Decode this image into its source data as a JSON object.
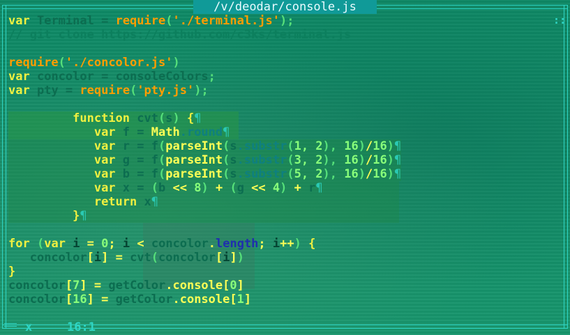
{
  "title": "/v/deodar/console.js",
  "corner_mark": "::",
  "status": {
    "mode": "x",
    "position": "16:1"
  },
  "colors": {
    "background": "#128a63",
    "frame": "#2fd6c5",
    "title_bg": "#109a98"
  },
  "lines": [
    [
      [
        "var",
        "kw"
      ],
      [
        " ",
        ""
      ],
      [
        "Terminal",
        "var-dim"
      ],
      [
        " = ",
        "op"
      ],
      [
        "require",
        "str"
      ],
      [
        "(",
        "brk"
      ],
      [
        "'./terminal.js'",
        "str"
      ],
      [
        ");",
        "brk"
      ]
    ],
    [
      [
        "// git clone https://github.com/c3ks/terminal.js",
        "cmt"
      ]
    ],
    [],
    [
      [
        "require",
        "str"
      ],
      [
        "(",
        "brk"
      ],
      [
        "'./concolor.js'",
        "str"
      ],
      [
        ")",
        "brk"
      ]
    ],
    [
      [
        "var",
        "kw"
      ],
      [
        " ",
        ""
      ],
      [
        "concolor",
        "var-dim"
      ],
      [
        " = ",
        "op"
      ],
      [
        "consoleColors",
        "var-dim"
      ],
      [
        ";",
        "brk"
      ]
    ],
    [
      [
        "var",
        "kw"
      ],
      [
        " ",
        ""
      ],
      [
        "pty",
        "var-dim"
      ],
      [
        " = ",
        "op"
      ],
      [
        "require",
        "str"
      ],
      [
        "(",
        "brk"
      ],
      [
        "'pty.js'",
        "str"
      ],
      [
        ");",
        "brk"
      ]
    ],
    [],
    [
      [
        "         ",
        ""
      ],
      [
        "function",
        "kw"
      ],
      [
        " ",
        ""
      ],
      [
        "cvt",
        "var-dim"
      ],
      [
        "(",
        "brk"
      ],
      [
        "s",
        "var-dim"
      ],
      [
        ")",
        "brk"
      ],
      [
        " {",
        "kw"
      ],
      [
        "¶",
        "pil"
      ]
    ],
    [
      [
        "            ",
        ""
      ],
      [
        "var",
        "kw"
      ],
      [
        " ",
        ""
      ],
      [
        "f",
        "var-dim"
      ],
      [
        " = ",
        "op"
      ],
      [
        "Math",
        "fn"
      ],
      [
        ".round",
        "prop"
      ],
      [
        "¶",
        "pil"
      ]
    ],
    [
      [
        "            ",
        ""
      ],
      [
        "var",
        "kw"
      ],
      [
        " ",
        ""
      ],
      [
        "r",
        "var-dim"
      ],
      [
        " = ",
        "op"
      ],
      [
        "f",
        "var-dim"
      ],
      [
        "(",
        "brk"
      ],
      [
        "parseInt",
        "fn"
      ],
      [
        "(",
        "brk"
      ],
      [
        "s",
        "var-dim"
      ],
      [
        ".substr",
        "prop"
      ],
      [
        "(",
        "brk"
      ],
      [
        "1",
        "num"
      ],
      [
        ", ",
        "num"
      ],
      [
        "2",
        "num"
      ],
      [
        ")",
        "brk"
      ],
      [
        ", ",
        "brk"
      ],
      [
        "16",
        "num"
      ],
      [
        ")",
        "brk"
      ],
      [
        "/",
        "fn"
      ],
      [
        "16",
        "num"
      ],
      [
        ")",
        "brk"
      ],
      [
        "¶",
        "pil"
      ]
    ],
    [
      [
        "            ",
        ""
      ],
      [
        "var",
        "kw"
      ],
      [
        " ",
        ""
      ],
      [
        "g",
        "var-dim"
      ],
      [
        " = ",
        "op"
      ],
      [
        "f",
        "var-dim"
      ],
      [
        "(",
        "brk"
      ],
      [
        "parseInt",
        "fn"
      ],
      [
        "(",
        "brk"
      ],
      [
        "s",
        "var-dim"
      ],
      [
        ".substr",
        "prop"
      ],
      [
        "(",
        "brk"
      ],
      [
        "3",
        "num"
      ],
      [
        ", ",
        "num"
      ],
      [
        "2",
        "num"
      ],
      [
        ")",
        "brk"
      ],
      [
        ", ",
        "brk"
      ],
      [
        "16",
        "num"
      ],
      [
        ")",
        "brk"
      ],
      [
        "/",
        "fn"
      ],
      [
        "16",
        "num"
      ],
      [
        ")",
        "brk"
      ],
      [
        "¶",
        "pil"
      ]
    ],
    [
      [
        "            ",
        ""
      ],
      [
        "var",
        "kw"
      ],
      [
        " ",
        ""
      ],
      [
        "b",
        "var-dim"
      ],
      [
        " = ",
        "op"
      ],
      [
        "f",
        "var-dim"
      ],
      [
        "(",
        "brk"
      ],
      [
        "parseInt",
        "fn"
      ],
      [
        "(",
        "brk"
      ],
      [
        "s",
        "var-dim"
      ],
      [
        ".substr",
        "prop"
      ],
      [
        "(",
        "brk"
      ],
      [
        "5",
        "num"
      ],
      [
        ", ",
        "num"
      ],
      [
        "2",
        "num"
      ],
      [
        ")",
        "brk"
      ],
      [
        ", ",
        "brk"
      ],
      [
        "16",
        "num"
      ],
      [
        ")",
        "brk"
      ],
      [
        "/",
        "fn"
      ],
      [
        "16",
        "num"
      ],
      [
        ")",
        "brk"
      ],
      [
        "¶",
        "pil"
      ]
    ],
    [
      [
        "            ",
        ""
      ],
      [
        "var",
        "kw"
      ],
      [
        " ",
        ""
      ],
      [
        "x",
        "var-dim"
      ],
      [
        " = ",
        "op"
      ],
      [
        "(",
        "brk"
      ],
      [
        "b",
        "var-dim"
      ],
      [
        " << ",
        "fn"
      ],
      [
        "8",
        "num"
      ],
      [
        ")",
        "brk"
      ],
      [
        " + ",
        "fn"
      ],
      [
        "(",
        "brk"
      ],
      [
        "g",
        "var-dim"
      ],
      [
        " << ",
        "fn"
      ],
      [
        "4",
        "num"
      ],
      [
        ")",
        "brk"
      ],
      [
        " + ",
        "fn"
      ],
      [
        "r",
        "var-dim"
      ],
      [
        "¶",
        "pil"
      ]
    ],
    [
      [
        "            ",
        ""
      ],
      [
        "return",
        "kw"
      ],
      [
        " ",
        ""
      ],
      [
        "x",
        "var-dim"
      ],
      [
        "¶",
        "pil"
      ]
    ],
    [
      [
        "         ",
        ""
      ],
      [
        "}",
        "kw"
      ],
      [
        "¶",
        "pil"
      ]
    ],
    [],
    [
      [
        "for",
        "kw"
      ],
      [
        " ",
        ""
      ],
      [
        "(",
        "brk"
      ],
      [
        "var",
        "kw"
      ],
      [
        " ",
        ""
      ],
      [
        "i",
        "dark"
      ],
      [
        " = ",
        "fn"
      ],
      [
        "0",
        "num"
      ],
      [
        "; ",
        "fn"
      ],
      [
        "i",
        "dark"
      ],
      [
        " < ",
        "fn"
      ],
      [
        "concolor",
        "var-dim"
      ],
      [
        ".",
        "fn"
      ],
      [
        "length",
        "blue"
      ],
      [
        "; ",
        "fn"
      ],
      [
        "i",
        "dark"
      ],
      [
        "++",
        "fn"
      ],
      [
        ")",
        "brk"
      ],
      [
        " {",
        "kw"
      ]
    ],
    [
      [
        "   ",
        ""
      ],
      [
        "concolor",
        "var-dim"
      ],
      [
        "[",
        "fn"
      ],
      [
        "i",
        "dark"
      ],
      [
        "]",
        "fn"
      ],
      [
        " = ",
        "fn"
      ],
      [
        "cvt",
        "var-dim"
      ],
      [
        "(",
        "brk"
      ],
      [
        "concolor",
        "var-dim"
      ],
      [
        "[",
        "fn"
      ],
      [
        "i",
        "dark"
      ],
      [
        "]",
        "fn"
      ],
      [
        ")",
        "brk"
      ]
    ],
    [
      [
        "}",
        "kw"
      ]
    ],
    [
      [
        "concolor",
        "var-dim"
      ],
      [
        "[",
        "fn"
      ],
      [
        "7",
        "num"
      ],
      [
        "]",
        "fn"
      ],
      [
        " = ",
        "fn"
      ],
      [
        "getColor",
        "var-dim"
      ],
      [
        ".console",
        "fn"
      ],
      [
        "[",
        "fn"
      ],
      [
        "0",
        "num"
      ],
      [
        "]",
        "fn"
      ]
    ],
    [
      [
        "concolor",
        "var-dim"
      ],
      [
        "[",
        "fn"
      ],
      [
        "16",
        "num"
      ],
      [
        "]",
        "fn"
      ],
      [
        " = ",
        "fn"
      ],
      [
        "getColor",
        "var-dim"
      ],
      [
        ".console",
        "fn"
      ],
      [
        "[",
        "fn"
      ],
      [
        "1",
        "num"
      ],
      [
        "]",
        "fn"
      ]
    ]
  ]
}
